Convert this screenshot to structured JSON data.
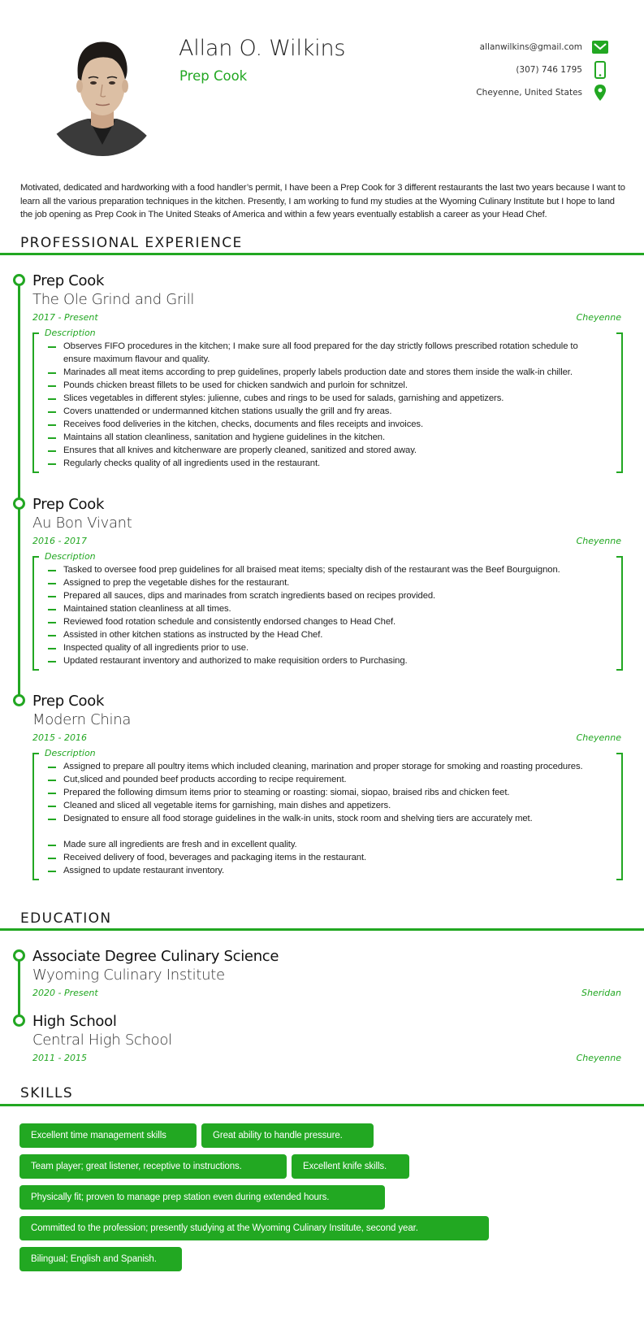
{
  "header": {
    "name": "Allan O. Wilkins",
    "role": "Prep Cook",
    "contacts": [
      {
        "text": "allanwilkins@gmail.com",
        "icon": "envelope-icon"
      },
      {
        "text": "(307) 746 1795",
        "icon": "mobile-phone-icon"
      },
      {
        "text": "Cheyenne, United States",
        "icon": "map-pin-icon"
      }
    ]
  },
  "summary": "Motivated, dedicated and hardworking with a food handler’s permit, I have been a Prep Cook for 3 different restaurants the last two years because I want to learn all the various preparation techniques in the kitchen. Presently, I am working to fund my studies at the Wyoming Culinary Institute but I hope to land the job opening as Prep Cook in The United Steaks of America and within a few years eventually establish a career as your Head Chef.",
  "sections": {
    "experience_title": "PROFESSIONAL EXPERIENCE",
    "education_title": "EDUCATION",
    "skills_title": "SKILLS"
  },
  "experience": [
    {
      "title": "Prep Cook",
      "org": "The Ole Grind and Grill",
      "dates": "2017 - Present",
      "location": "Cheyenne",
      "desc_label": "Description",
      "items": [
        "Observes FIFO procedures in the kitchen; I make sure all food prepared for the day strictly follows prescribed rotation schedule to ensure maximum flavour and quality.",
        "Marinades all meat items according to prep guidelines, properly labels production date and stores them inside the walk-in chiller.",
        "Pounds chicken breast fillets to be used for chicken sandwich and purloin for schnitzel.",
        "Slices vegetables in different styles: julienne, cubes and rings to be used for salads, garnishing and appetizers.",
        "Covers unattended or undermanned kitchen stations usually the grill and fry areas.",
        "Receives food deliveries in the kitchen, checks, documents and files receipts and invoices.",
        "Maintains all station cleanliness, sanitation and hygiene guidelines in the kitchen.",
        "Ensures that all knives and kitchenware are properly cleaned, sanitized and stored away.",
        "Regularly checks quality of all ingredients used in the restaurant."
      ]
    },
    {
      "title": "Prep Cook",
      "org": "Au Bon Vivant",
      "dates": "2016 - 2017",
      "location": "Cheyenne",
      "desc_label": "Description",
      "items": [
        "Tasked to oversee food prep guidelines for all braised meat items; specialty dish of the restaurant was the Beef Bourguignon.",
        "Assigned to prep the vegetable dishes for the restaurant.",
        "Prepared all sauces, dips and marinades from scratch ingredients based on recipes provided.",
        "Maintained station cleanliness at all times.",
        "Reviewed food rotation schedule and consistently endorsed changes to Head Chef.",
        "Assisted in other kitchen stations as instructed by the Head Chef.",
        "Inspected quality of all ingredients prior to use.",
        "Updated restaurant inventory and authorized to make requisition orders to Purchasing."
      ]
    },
    {
      "title": "Prep Cook",
      "org": "Modern China",
      "dates": "2015 - 2016",
      "location": "Cheyenne",
      "desc_label": "Description",
      "items": [
        "Assigned to prepare all poultry items which included cleaning, marination and proper storage for smoking and roasting procedures.",
        "Cut,sliced and pounded beef products according to recipe requirement.",
        "Prepared the following dimsum items prior to steaming or roasting: siomai, siopao, braised ribs and chicken feet.",
        "Cleaned and sliced all vegetable items for garnishing, main dishes and appetizers.",
        "Designated to ensure all food storage guidelines in the walk-in units, stock room and shelving tiers are accurately met.",
        "",
        "Made sure all ingredients are fresh and in excellent quality.",
        "Received delivery of food, beverages and packaging items in the restaurant.",
        "Assigned to update restaurant inventory."
      ]
    }
  ],
  "education": [
    {
      "title": "Associate Degree Culinary Science",
      "org": "Wyoming Culinary Institute",
      "dates": "2020 - Present",
      "location": "Sheridan"
    },
    {
      "title": "High School",
      "org": "Central High School",
      "dates": "2011 - 2015",
      "location": "Cheyenne"
    }
  ],
  "skills": [
    [
      "Excellent time management skills",
      "Great ability to handle pressure."
    ],
    [
      "Team player; great listener, receptive to instructions.",
      "Excellent knife skills."
    ],
    [
      "Physically fit; proven to manage prep station even during extended hours."
    ],
    [
      "Committed to the profession; presently studying at the Wyoming Culinary Institute, second year."
    ],
    [
      "Bilingual; English and Spanish."
    ]
  ],
  "colors": {
    "accent": "#22a722",
    "text": "#222222"
  }
}
